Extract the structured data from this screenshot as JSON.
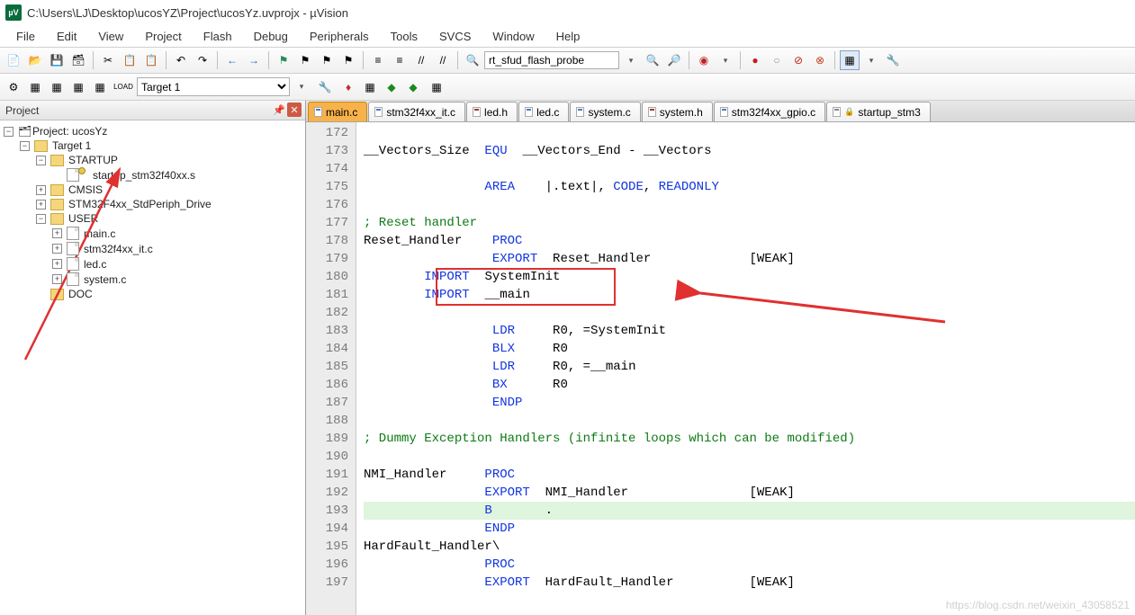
{
  "window": {
    "title": "C:\\Users\\LJ\\Desktop\\ucosYZ\\Project\\ucosYz.uvprojx - µVision"
  },
  "menu": [
    "File",
    "Edit",
    "View",
    "Project",
    "Flash",
    "Debug",
    "Peripherals",
    "Tools",
    "SVCS",
    "Window",
    "Help"
  ],
  "toolbar": {
    "search_value": "rt_sfud_flash_probe"
  },
  "toolbar2": {
    "target": "Target 1"
  },
  "project_panel": {
    "title": "Project",
    "root": "Project: ucosYz",
    "target": "Target 1",
    "groups": [
      {
        "name": "STARTUP",
        "open": true,
        "files": [
          "startup_stm32f40xx.s"
        ],
        "key": true
      },
      {
        "name": "CMSIS",
        "open": false,
        "files": []
      },
      {
        "name": "STM32F4xx_StdPeriph_Drive",
        "open": false,
        "files": []
      },
      {
        "name": "USER",
        "open": true,
        "files": [
          "main.c",
          "stm32f4xx_it.c",
          "led.c",
          "system.c"
        ]
      },
      {
        "name": "DOC",
        "open": false,
        "files": [],
        "leaf": true
      }
    ]
  },
  "tabs": [
    {
      "label": "main.c",
      "kind": "c",
      "active": true
    },
    {
      "label": "stm32f4xx_it.c",
      "kind": "c"
    },
    {
      "label": "led.h",
      "kind": "h"
    },
    {
      "label": "led.c",
      "kind": "c"
    },
    {
      "label": "system.c",
      "kind": "c"
    },
    {
      "label": "system.h",
      "kind": "h"
    },
    {
      "label": "stm32f4xx_gpio.c",
      "kind": "c"
    },
    {
      "label": "startup_stm3",
      "kind": "s",
      "lock": true
    }
  ],
  "code": {
    "first_line": 172,
    "lines": [
      {
        "n": 172,
        "t": ""
      },
      {
        "n": 173,
        "t": "__Vectors_Size  EQU  __Vectors_End - __Vectors",
        "kw": [
          "EQU"
        ]
      },
      {
        "n": 174,
        "t": ""
      },
      {
        "n": 175,
        "t": "                AREA    |.text|, CODE, READONLY",
        "kw": [
          "AREA",
          "CODE",
          "READONLY"
        ]
      },
      {
        "n": 176,
        "t": ""
      },
      {
        "n": 177,
        "t": "; Reset handler",
        "cm": true
      },
      {
        "n": 178,
        "t": "Reset_Handler    PROC",
        "kw": [
          "PROC"
        ]
      },
      {
        "n": 179,
        "t": "                 EXPORT  Reset_Handler             [WEAK]",
        "kw": [
          "EXPORT"
        ]
      },
      {
        "n": 180,
        "t": "        IMPORT  SystemInit",
        "kw": [
          "IMPORT"
        ]
      },
      {
        "n": 181,
        "t": "        IMPORT  __main",
        "kw": [
          "IMPORT"
        ]
      },
      {
        "n": 182,
        "t": ""
      },
      {
        "n": 183,
        "t": "                 LDR     R0, =SystemInit",
        "kw": [
          "LDR"
        ]
      },
      {
        "n": 184,
        "t": "                 BLX     R0",
        "kw": [
          "BLX"
        ]
      },
      {
        "n": 185,
        "t": "                 LDR     R0, =__main",
        "kw": [
          "LDR"
        ]
      },
      {
        "n": 186,
        "t": "                 BX      R0",
        "kw": [
          "BX"
        ]
      },
      {
        "n": 187,
        "t": "                 ENDP",
        "kw": [
          "ENDP"
        ]
      },
      {
        "n": 188,
        "t": ""
      },
      {
        "n": 189,
        "t": "; Dummy Exception Handlers (infinite loops which can be modified)",
        "cm": true
      },
      {
        "n": 190,
        "t": ""
      },
      {
        "n": 191,
        "t": "NMI_Handler     PROC",
        "kw": [
          "PROC"
        ]
      },
      {
        "n": 192,
        "t": "                EXPORT  NMI_Handler                [WEAK]",
        "kw": [
          "EXPORT"
        ]
      },
      {
        "n": 193,
        "t": "                B       .",
        "kw": [
          "B"
        ],
        "cur": true
      },
      {
        "n": 194,
        "t": "                ENDP",
        "kw": [
          "ENDP"
        ]
      },
      {
        "n": 195,
        "t": "HardFault_Handler\\"
      },
      {
        "n": 196,
        "t": "                PROC",
        "kw": [
          "PROC"
        ]
      },
      {
        "n": 197,
        "t": "                EXPORT  HardFault_Handler          [WEAK]",
        "kw": [
          "EXPORT"
        ]
      }
    ]
  },
  "watermark": "https://blog.csdn.net/weixin_43058521"
}
